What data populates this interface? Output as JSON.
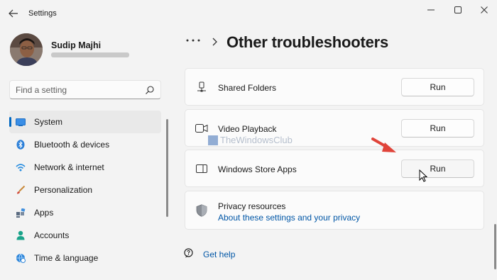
{
  "window": {
    "app_title": "Settings"
  },
  "profile": {
    "name": "Sudip Majhi"
  },
  "search": {
    "placeholder": "Find a setting"
  },
  "nav": {
    "items": [
      {
        "label": "System",
        "icon": "system-icon",
        "active": true
      },
      {
        "label": "Bluetooth & devices",
        "icon": "bluetooth-icon"
      },
      {
        "label": "Network & internet",
        "icon": "network-icon"
      },
      {
        "label": "Personalization",
        "icon": "brush-icon"
      },
      {
        "label": "Apps",
        "icon": "apps-icon"
      },
      {
        "label": "Accounts",
        "icon": "accounts-icon"
      },
      {
        "label": "Time & language",
        "icon": "globe-clock-icon"
      }
    ]
  },
  "header": {
    "more": "...",
    "title": "Other troubleshooters"
  },
  "troubleshooters": [
    {
      "label": "Shared Folders",
      "icon": "shared-folder-icon",
      "button": "Run"
    },
    {
      "label": "Video Playback",
      "icon": "video-camera-icon",
      "button": "Run"
    },
    {
      "label": "Windows Store Apps",
      "icon": "store-apps-icon",
      "button": "Run"
    }
  ],
  "privacy": {
    "title": "Privacy resources",
    "link": "About these settings and your privacy"
  },
  "watermark": {
    "text": "TheWindowsClub"
  },
  "help": {
    "label": "Get help"
  },
  "colors": {
    "accent": "#0067c0",
    "link": "#0056a6",
    "arrow": "#e0443a"
  }
}
